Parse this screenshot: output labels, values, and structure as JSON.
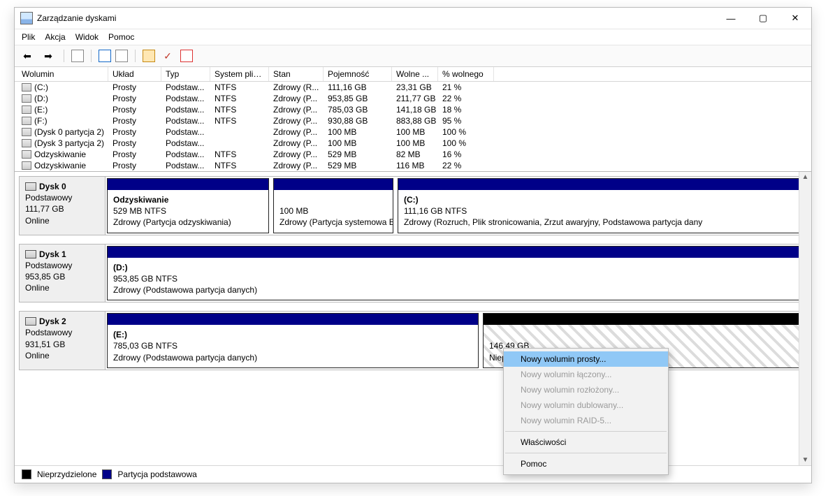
{
  "window": {
    "title": "Zarządzanie dyskami"
  },
  "menu": {
    "file": "Plik",
    "action": "Akcja",
    "view": "Widok",
    "help": "Pomoc"
  },
  "volume_headers": {
    "volume": "Wolumin",
    "layout": "Układ",
    "type": "Typ",
    "fs": "System plik...",
    "status": "Stan",
    "capacity": "Pojemność",
    "free": "Wolne ...",
    "pctfree": "% wolnego"
  },
  "volumes": [
    {
      "name": "(C:)",
      "layout": "Prosty",
      "type": "Podstaw...",
      "fs": "NTFS",
      "status": "Zdrowy (R...",
      "cap": "111,16 GB",
      "free": "23,31 GB",
      "pct": "21 %"
    },
    {
      "name": "(D:)",
      "layout": "Prosty",
      "type": "Podstaw...",
      "fs": "NTFS",
      "status": "Zdrowy (P...",
      "cap": "953,85 GB",
      "free": "211,77 GB",
      "pct": "22 %"
    },
    {
      "name": "(E:)",
      "layout": "Prosty",
      "type": "Podstaw...",
      "fs": "NTFS",
      "status": "Zdrowy (P...",
      "cap": "785,03 GB",
      "free": "141,18 GB",
      "pct": "18 %"
    },
    {
      "name": "(F:)",
      "layout": "Prosty",
      "type": "Podstaw...",
      "fs": "NTFS",
      "status": "Zdrowy (P...",
      "cap": "930,88 GB",
      "free": "883,88 GB",
      "pct": "95 %"
    },
    {
      "name": "(Dysk 0 partycja 2)",
      "layout": "Prosty",
      "type": "Podstaw...",
      "fs": "",
      "status": "Zdrowy (P...",
      "cap": "100 MB",
      "free": "100 MB",
      "pct": "100 %"
    },
    {
      "name": "(Dysk 3 partycja 2)",
      "layout": "Prosty",
      "type": "Podstaw...",
      "fs": "",
      "status": "Zdrowy (P...",
      "cap": "100 MB",
      "free": "100 MB",
      "pct": "100 %"
    },
    {
      "name": "Odzyskiwanie",
      "layout": "Prosty",
      "type": "Podstaw...",
      "fs": "NTFS",
      "status": "Zdrowy (P...",
      "cap": "529 MB",
      "free": "82 MB",
      "pct": "16 %"
    },
    {
      "name": "Odzyskiwanie",
      "layout": "Prosty",
      "type": "Podstaw...",
      "fs": "NTFS",
      "status": "Zdrowy (P...",
      "cap": "529 MB",
      "free": "116 MB",
      "pct": "22 %"
    }
  ],
  "disks": {
    "d0": {
      "name": "Dysk 0",
      "type": "Podstawowy",
      "size": "111,77 GB",
      "state": "Online",
      "p1_name": "Odzyskiwanie",
      "p1_sz": "529 MB NTFS",
      "p1_st": "Zdrowy (Partycja odzyskiwania)",
      "p2_sz": "100 MB",
      "p2_st": "Zdrowy (Partycja systemowa E",
      "p3_name": "(C:)",
      "p3_sz": "111,16 GB NTFS",
      "p3_st": "Zdrowy (Rozruch, Plik stronicowania, Zrzut awaryjny, Podstawowa partycja dany"
    },
    "d1": {
      "name": "Dysk 1",
      "type": "Podstawowy",
      "size": "953,85 GB",
      "state": "Online",
      "p1_name": "(D:)",
      "p1_sz": "953,85 GB NTFS",
      "p1_st": "Zdrowy (Podstawowa partycja danych)"
    },
    "d2": {
      "name": "Dysk 2",
      "type": "Podstawowy",
      "size": "931,51 GB",
      "state": "Online",
      "p1_name": "(E:)",
      "p1_sz": "785,03 GB NTFS",
      "p1_st": "Zdrowy (Podstawowa partycja danych)",
      "p2_sz": "146,49 GB",
      "p2_st": "Nieprzydz"
    }
  },
  "legend": {
    "unalloc": "Nieprzydzielone",
    "primary": "Partycja podstawowa"
  },
  "context_menu": {
    "new_simple": "Nowy wolumin prosty...",
    "new_spanned": "Nowy wolumin łączony...",
    "new_striped": "Nowy wolumin rozłożony...",
    "new_mirror": "Nowy wolumin dublowany...",
    "new_raid5": "Nowy wolumin RAID-5...",
    "properties": "Właściwości",
    "help": "Pomoc"
  }
}
